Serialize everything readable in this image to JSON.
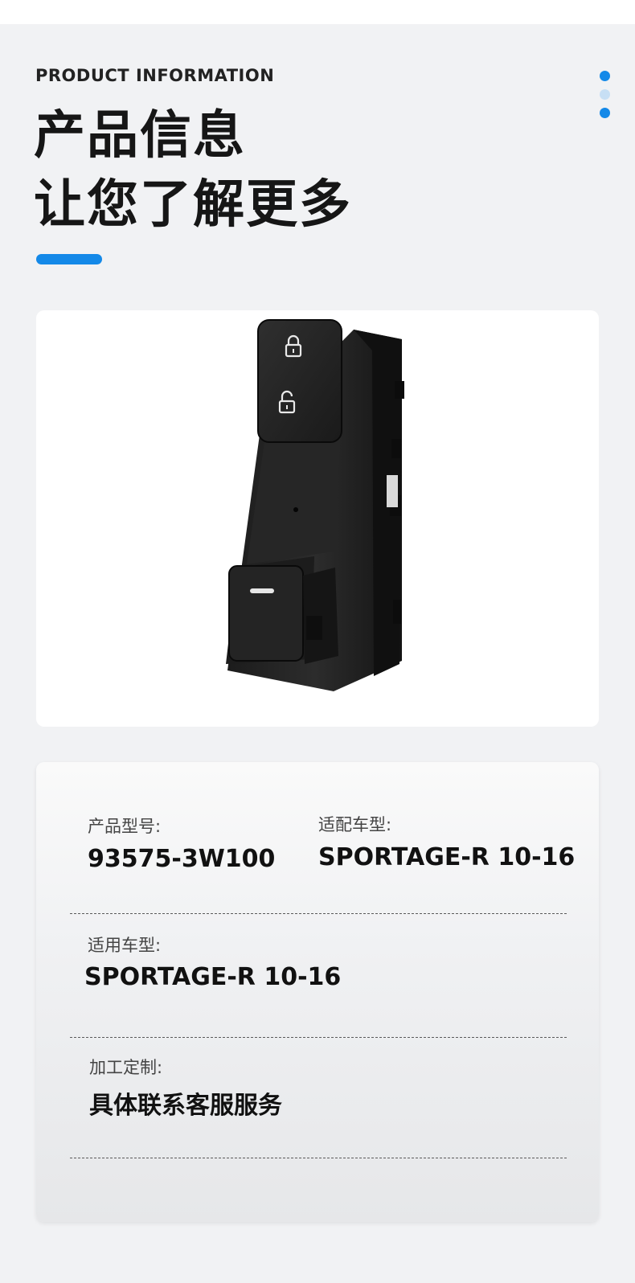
{
  "header": {
    "eyebrow": "PRODUCT INFORMATION",
    "title_line1": "产品信息",
    "title_line2": "让您了解更多"
  },
  "colors": {
    "accent": "#1489e8",
    "accent_light": "#c7dff4",
    "background": "#f1f2f4"
  },
  "pager_dots": [
    {
      "state": "active"
    },
    {
      "state": "inactive"
    },
    {
      "state": "active"
    }
  ],
  "product_image": {
    "icon_top": "lock-icon",
    "icon_bottom": "unlock-icon"
  },
  "info": {
    "model_label": "产品型号:",
    "model_value": "93575-3W100",
    "fit_label": "适配车型:",
    "fit_value": "SPORTAGE-R 10-16",
    "apply_label": "适用车型:",
    "apply_value": "SPORTAGE-R 10-16",
    "custom_label": "加工定制:",
    "custom_value": "具体联系客服服务"
  }
}
